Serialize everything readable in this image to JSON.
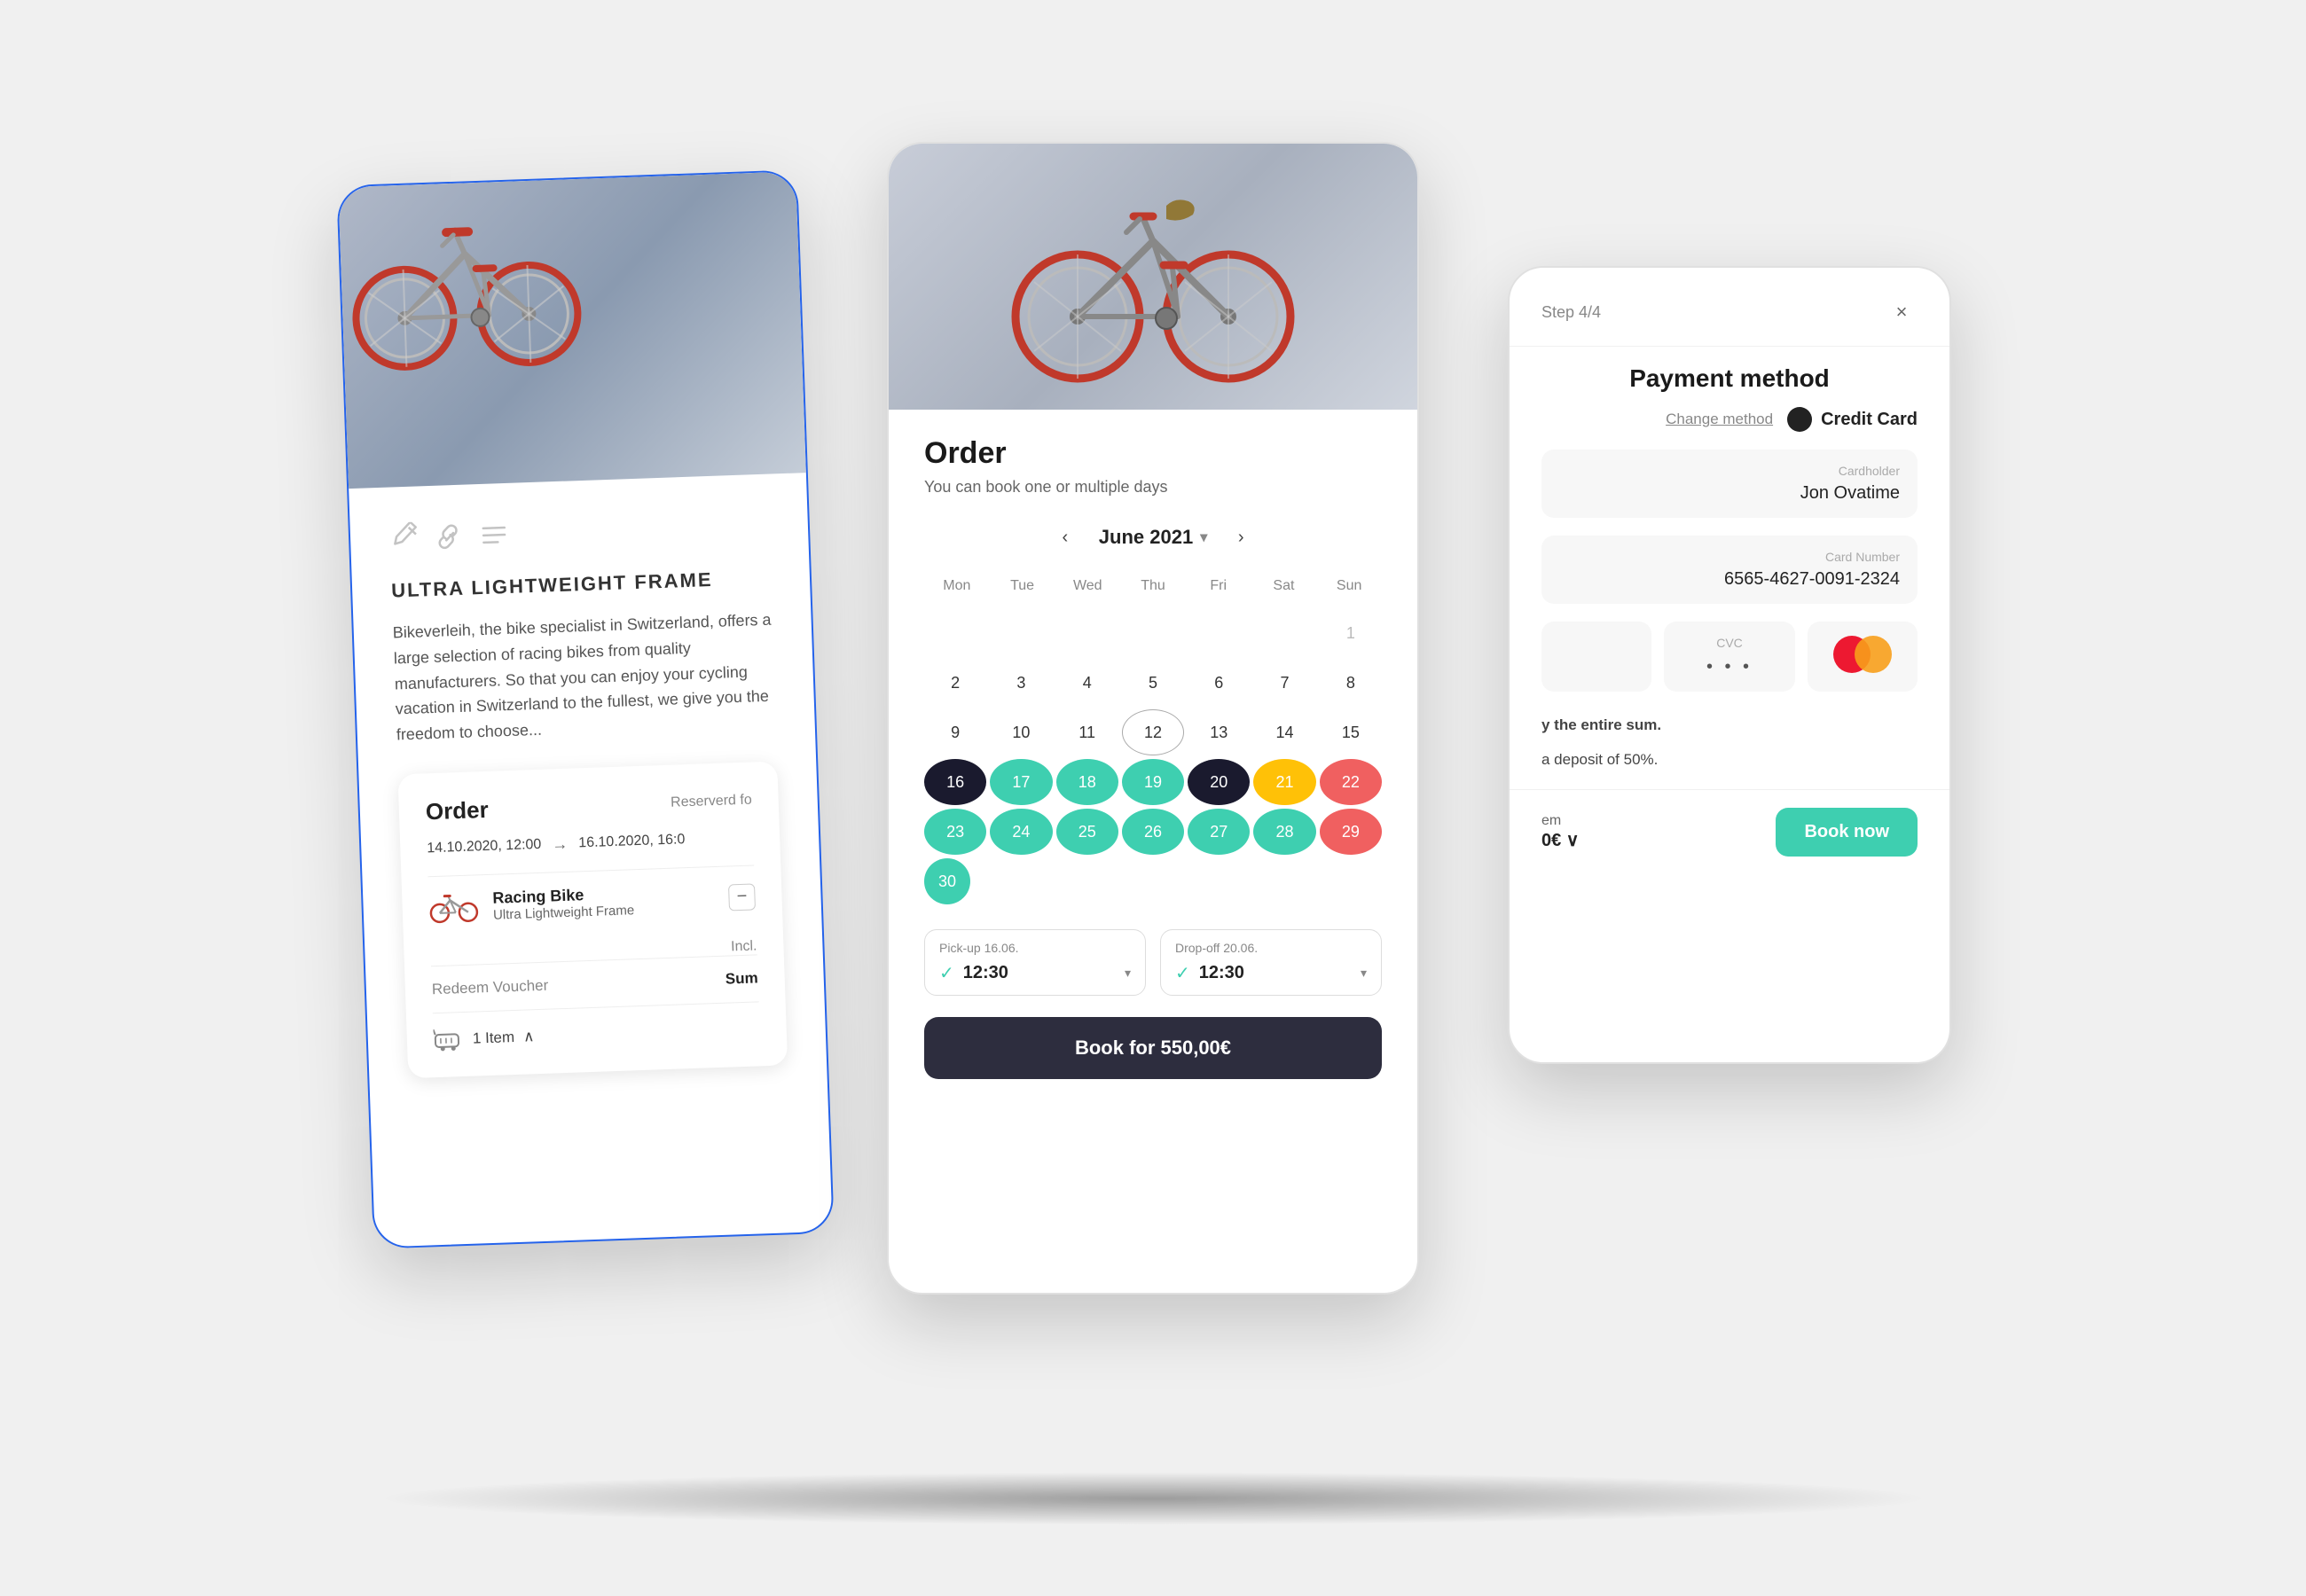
{
  "scene": {
    "background": "#f0f0f0"
  },
  "left_card": {
    "product": {
      "title": "ULTRA LIGHTWEIGHT FRAME",
      "description": "Bikeverleih, the bike specialist in Switzerland, offers a large selection of racing bikes from quality manufacturers. So that you can enjoy your cycling vacation in Switzerland to the fullest, we give you the freedom to choose...",
      "edit_icons": [
        "edit-icon",
        "link-icon",
        "lines-icon"
      ]
    },
    "order": {
      "title": "Order",
      "reserved_label": "Reserverd fo",
      "date_from": "14.10.2020, 12:00",
      "date_to": "16.10.2020, 16:0",
      "item_name": "Racing Bike",
      "item_sub": "Ultra Lightweight Frame",
      "incl_label": "Incl.",
      "voucher_label": "Redeem Voucher",
      "sum_label": "Sum",
      "items_count": "1 Item",
      "cart_label": "^"
    }
  },
  "center_card": {
    "order": {
      "heading": "Order",
      "subtext": "You can book one or multiple days"
    },
    "calendar": {
      "month": "June 2021",
      "days": [
        "Mon",
        "Tue",
        "Wed",
        "Thu",
        "Fri",
        "Sat",
        "Sun"
      ],
      "weeks": [
        [
          "",
          "",
          "",
          "",
          "",
          "",
          "1"
        ],
        [
          "2",
          "3",
          "4",
          "5",
          "6",
          "7",
          "8"
        ],
        [
          "9",
          "10",
          "11",
          "12",
          "13",
          "14",
          "15"
        ],
        [
          "16",
          "17",
          "18",
          "19",
          "20",
          "21",
          "22"
        ],
        [
          "23",
          "24",
          "25",
          "26",
          "27",
          "28",
          "29"
        ],
        [
          "30",
          "",
          "",
          "",
          "",
          "",
          ""
        ]
      ],
      "cell_styles": {
        "1": "faded",
        "2": "normal",
        "3": "normal",
        "4": "normal",
        "5": "normal",
        "6": "normal",
        "7": "normal",
        "8": "normal",
        "9": "normal",
        "10": "normal",
        "11": "normal",
        "12": "circle",
        "13": "normal",
        "14": "normal",
        "15": "normal",
        "16": "selected-dark",
        "17": "in-range-teal",
        "18": "in-range-teal",
        "19": "in-range-teal",
        "20": "selected-end",
        "21": "yellow",
        "22": "red",
        "23": "teal-range",
        "24": "teal-range",
        "25": "teal-range",
        "26": "teal-range",
        "27": "teal-range",
        "28": "teal-range",
        "29": "red",
        "30": "teal-30"
      }
    },
    "pickup": {
      "label": "Pick-up 16.06.",
      "time": "12:30"
    },
    "dropoff": {
      "label": "Drop-off 20.06.",
      "time": "12:30"
    },
    "book_button": "Book for 550,00€"
  },
  "right_card": {
    "step": "Step 4/4",
    "close_label": "×",
    "title": "Payment method",
    "change_method": "Change method",
    "payment_type": "Credit Card",
    "cardholder": {
      "label": "Cardholder",
      "value": "Jon Ovatime"
    },
    "card_number": {
      "label": "Card Number",
      "value": "6565-4627-0091-2324"
    },
    "cvc": {
      "label": "CVC",
      "dots": "• • •"
    },
    "info": {
      "full": "y the entire sum.",
      "deposit": "a deposit of 50%."
    },
    "footer": {
      "item_label": "em",
      "amount": "0€",
      "book_label": "Book now"
    }
  }
}
